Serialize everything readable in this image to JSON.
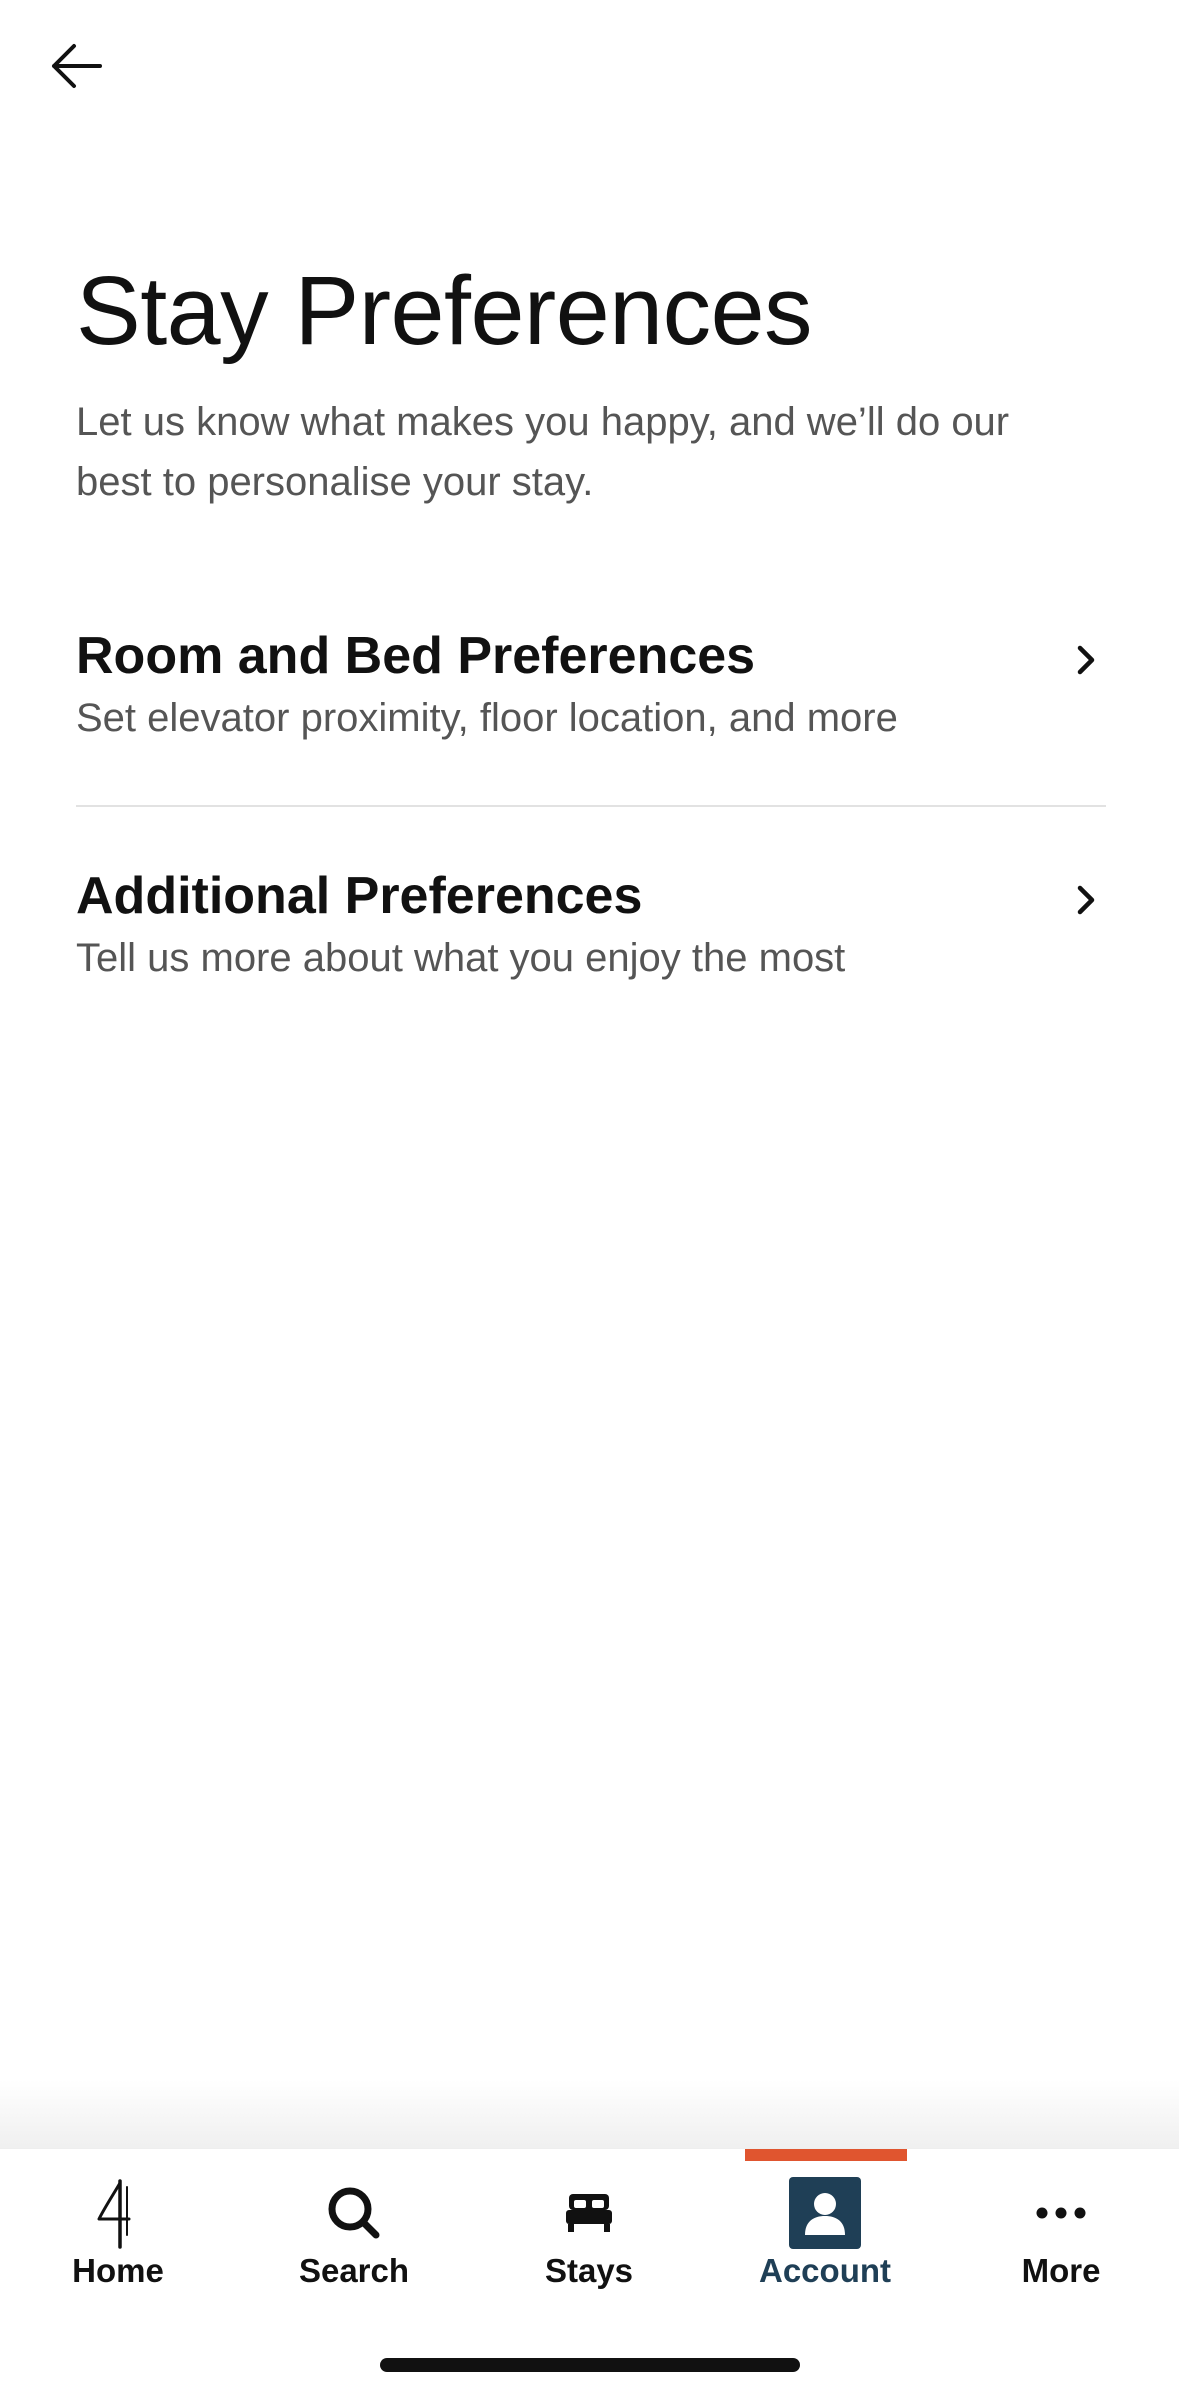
{
  "header": {
    "back_icon": "arrow-left-icon"
  },
  "page": {
    "title": "Stay Preferences",
    "subtitle": "Let us know what makes you happy, and we’ll do our best to personalise your stay."
  },
  "preferences": [
    {
      "title": "Room and Bed Preferences",
      "description": "Set elevator proximity, floor location, and more",
      "icon": "chevron-right-icon"
    },
    {
      "title": "Additional Preferences",
      "description": "Tell us more about what you enjoy the most",
      "icon": "chevron-right-icon"
    }
  ],
  "tab_bar": {
    "tabs": [
      {
        "label": "Home",
        "icon": "brand-logo-icon"
      },
      {
        "label": "Search",
        "icon": "search-icon"
      },
      {
        "label": "Stays",
        "icon": "bed-icon"
      },
      {
        "label": "Account",
        "icon": "account-icon",
        "active": true
      },
      {
        "label": "More",
        "icon": "more-dots-icon"
      }
    ],
    "active_indicator_color": "#e0552f",
    "active_label_color": "#1f3f56",
    "account_icon_background": "#1f3f56"
  }
}
